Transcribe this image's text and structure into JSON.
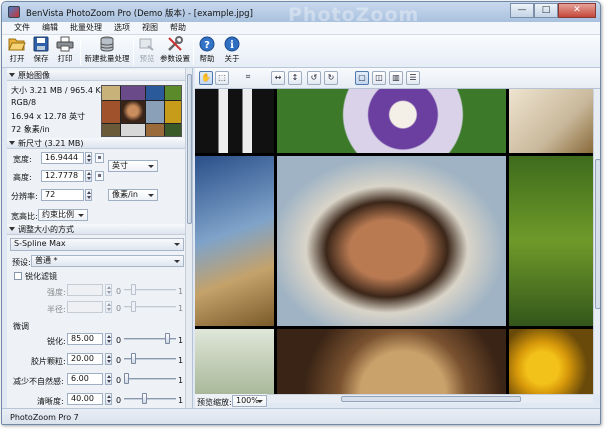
{
  "window": {
    "title": "BenVista PhotoZoom Pro        (Demo 版本) - [example.jpg]",
    "watermark": "PhotoZoom",
    "minimize": "—",
    "maximize": "□",
    "close": "✕"
  },
  "menu": [
    "文件",
    "编辑",
    "批量处理",
    "选项",
    "视图",
    "帮助"
  ],
  "toolbar": [
    {
      "label": "打开",
      "icon": "folder-open-icon",
      "enabled": true
    },
    {
      "label": "保存",
      "icon": "floppy-disk-icon",
      "enabled": true
    },
    {
      "label": "打印",
      "icon": "printer-icon",
      "enabled": true
    },
    {
      "label": "新建批量处理",
      "icon": "database-stack-icon",
      "enabled": true
    },
    {
      "label": "预览",
      "icon": "preview-icon",
      "enabled": false
    },
    {
      "label": "参数设置",
      "icon": "wrench-tools-icon",
      "enabled": true
    },
    {
      "label": "帮助",
      "icon": "help-question-icon",
      "enabled": true
    },
    {
      "label": "关于",
      "icon": "info-icon",
      "enabled": true
    }
  ],
  "original": {
    "header": "原始图像",
    "size": "大小 3.21 MB / 965.4 KB",
    "color": "RGB/8",
    "dims": "16.94 x 12.78 英寸",
    "res": "72 象素/in"
  },
  "newsize": {
    "header": "新尺寸 (3.21 MB)",
    "width_label": "宽度:",
    "width": "16.9444",
    "height_label": "高度:",
    "height": "12.7778",
    "unit": "英寸",
    "res_label": "分辨率:",
    "res": "72",
    "res_unit": "像素/in",
    "aspect_label": "宽高比:",
    "aspect": "约束比例"
  },
  "method": {
    "header": "调整大小的方式",
    "algorithm": "S-Spline Max",
    "preset_label": "预设:",
    "preset": "普通 *",
    "sharpen_filter": "锐化滤镜",
    "strength_label": "强度:",
    "radius_label": "半径:",
    "zero": "0",
    "one": "1",
    "finetune": "微调",
    "sharpen_label": "锐化:",
    "sharpen": "85.00",
    "film_label": "胶片颗粒:",
    "film": "20.00",
    "artifact_label": "减少不自然感:",
    "artifact": "6.00",
    "clarity_label": "清晰度:",
    "clarity": "40.00"
  },
  "sliders": {
    "strength": 0.2,
    "radius": 0.2,
    "sharpen": 0.85,
    "film": 0.2,
    "artifact": 0.06,
    "clarity": 0.4
  },
  "preview": {
    "zoom_label": "预览缩放:",
    "zoom": "100%"
  },
  "status": "PhotoZoom Pro 7"
}
